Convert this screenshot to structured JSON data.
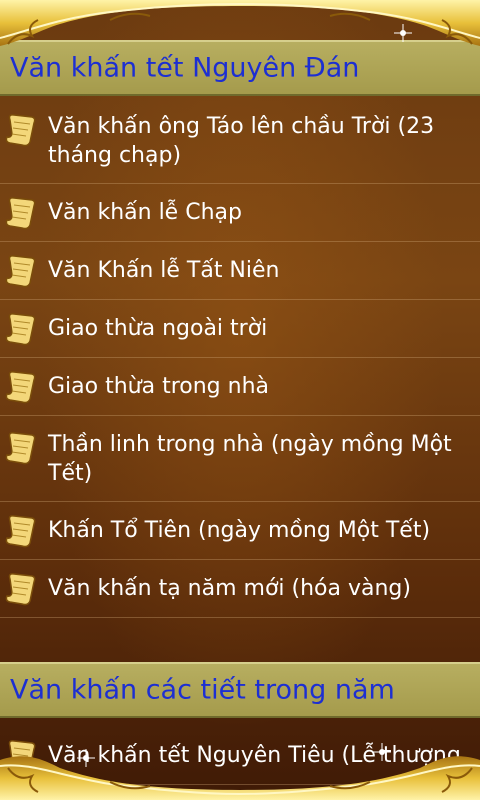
{
  "sections": [
    {
      "title": "Văn khấn tết Nguyên Đán",
      "items": [
        {
          "label": "Văn khấn ông Táo lên chầu Trời (23 tháng chạp)",
          "icon": "scroll-icon"
        },
        {
          "label": "Văn khấn lễ Chạp",
          "icon": "scroll-icon"
        },
        {
          "label": "Văn Khấn lễ Tất Niên",
          "icon": "scroll-icon"
        },
        {
          "label": "Giao thừa ngoài trời",
          "icon": "scroll-icon"
        },
        {
          "label": "Giao thừa trong nhà",
          "icon": "scroll-icon"
        },
        {
          "label": "Thần linh trong nhà (ngày mồng Một Tết)",
          "icon": "scroll-icon"
        },
        {
          "label": "Khấn Tổ Tiên (ngày mồng Một Tết)",
          "icon": "scroll-icon"
        },
        {
          "label": "Văn khấn tạ năm mới (hóa vàng)",
          "icon": "scroll-icon"
        }
      ]
    },
    {
      "title": "Văn khấn các tiết trong năm",
      "items": [
        {
          "label": "Văn khấn tết Nguyên Tiêu (Lễ thượng",
          "icon": "scroll-icon"
        }
      ]
    }
  ],
  "colors": {
    "header_text": "#1d2fd2",
    "header_bg": "#b7ae60",
    "item_text": "#ffffff",
    "frame_gold": "#e8c03a"
  }
}
